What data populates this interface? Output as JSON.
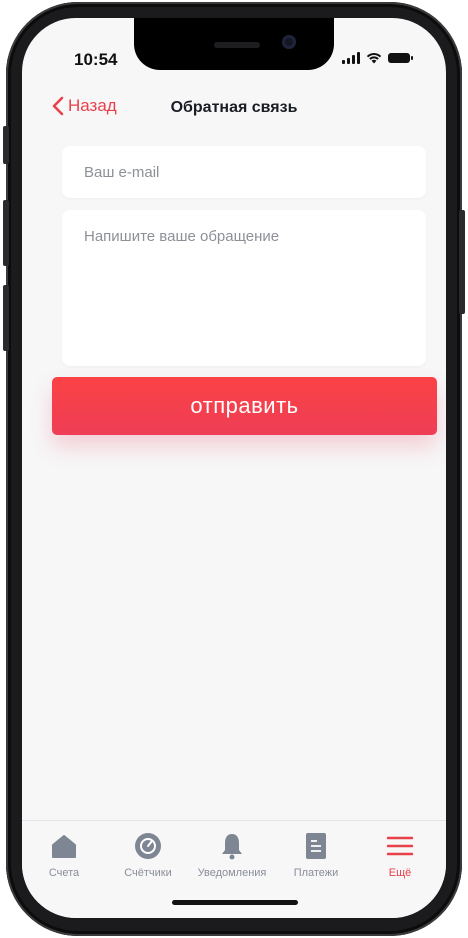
{
  "status_bar": {
    "time": "10:54"
  },
  "nav": {
    "back_label": "Назад",
    "title": "Обратная связь"
  },
  "form": {
    "email_placeholder": "Ваш e-mail",
    "message_placeholder": "Напишите ваше обращение",
    "submit_label": "отправить"
  },
  "tabs": [
    {
      "label": "Счета",
      "icon": "home-icon",
      "active": false
    },
    {
      "label": "Счётчики",
      "icon": "gauge-icon",
      "active": false
    },
    {
      "label": "Уведомления",
      "icon": "bell-icon",
      "active": false
    },
    {
      "label": "Платежи",
      "icon": "document-icon",
      "active": false
    },
    {
      "label": "Ещё",
      "icon": "menu-icon",
      "active": true
    }
  ],
  "colors": {
    "accent": "#e8414b",
    "tab_inactive": "#7e8694",
    "background": "#f7f7f8"
  }
}
